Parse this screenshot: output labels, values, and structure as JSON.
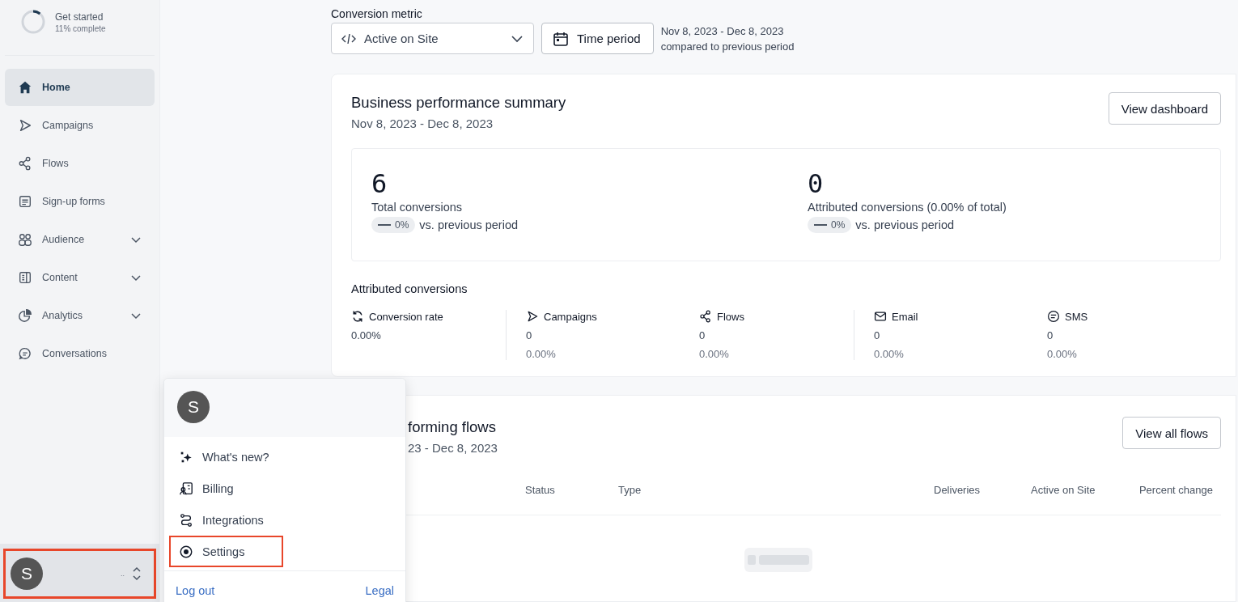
{
  "onboarding": {
    "title": "Get started",
    "progress_text": "11% complete",
    "level": 0.11
  },
  "sidebar": {
    "items": [
      {
        "label": "Home",
        "selected": true,
        "expandable": false
      },
      {
        "label": "Campaigns",
        "selected": false,
        "expandable": false
      },
      {
        "label": "Flows",
        "selected": false,
        "expandable": false
      },
      {
        "label": "Sign-up forms",
        "selected": false,
        "expandable": false
      },
      {
        "label": "Audience",
        "selected": false,
        "expandable": true
      },
      {
        "label": "Content",
        "selected": false,
        "expandable": true
      },
      {
        "label": "Analytics",
        "selected": false,
        "expandable": true
      },
      {
        "label": "Conversations",
        "selected": false,
        "expandable": false
      }
    ],
    "account": {
      "avatar_letter": "S",
      "name": "..",
      "highlighted": true
    }
  },
  "filters": {
    "metric_label": "Conversion metric",
    "metric_value": "Active on Site",
    "time_button": "Time period",
    "date_range": "Nov 8, 2023 - Dec 8, 2023",
    "comparison": "compared to previous period"
  },
  "summary": {
    "title": "Business performance summary",
    "date_range": "Nov 8, 2023 - Dec 8, 2023",
    "button": "View dashboard",
    "stats": [
      {
        "value": "6",
        "label": "Total conversions",
        "change": "0%",
        "change_text": "vs. previous period"
      },
      {
        "value": "0",
        "label": "Attributed conversions (0.00% of total)",
        "change": "0%",
        "change_text": "vs. previous period"
      }
    ],
    "attributed_title": "Attributed conversions",
    "metrics": [
      {
        "label": "Conversion rate",
        "values": [
          "0.00%"
        ],
        "divider_before": false
      },
      {
        "label": "Campaigns",
        "values": [
          "0",
          "0.00%"
        ],
        "divider_before": true
      },
      {
        "label": "Flows",
        "values": [
          "0",
          "0.00%"
        ],
        "divider_before": false
      },
      {
        "label": "Email",
        "values": [
          "0",
          "0.00%"
        ],
        "divider_before": true
      },
      {
        "label": "SMS",
        "values": [
          "0",
          "0.00%"
        ],
        "divider_before": false
      }
    ]
  },
  "flows": {
    "title": "forming flows",
    "date_range": "23 - Dec 8, 2023",
    "button": "View all flows",
    "columns": [
      "Status",
      "Type",
      "Deliveries",
      "Active on Site",
      "Percent change"
    ]
  },
  "account_menu": {
    "avatar_letter": "S",
    "items": [
      {
        "label": "What's new?",
        "highlighted": false
      },
      {
        "label": "Billing",
        "highlighted": false
      },
      {
        "label": "Integrations",
        "highlighted": false
      },
      {
        "label": "Settings",
        "highlighted": true
      }
    ],
    "footer_links": [
      "Log out",
      "Legal"
    ]
  }
}
